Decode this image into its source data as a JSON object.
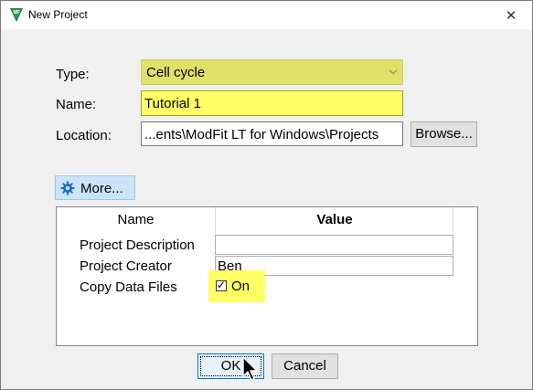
{
  "window": {
    "title": "New Project",
    "close_glyph": "✕",
    "app_icon": "modfit-app-icon"
  },
  "form": {
    "type_label": "Type:",
    "type_value": "Cell cycle",
    "type_arrow": "⌵",
    "name_label": "Name:",
    "name_value": "Tutorial 1",
    "location_label": "Location:",
    "location_value": "...ents\\ModFit LT for Windows\\Projects",
    "browse_label": "Browse..."
  },
  "more_button": {
    "label": "More...",
    "icon": "gear-icon"
  },
  "properties": {
    "header_name": "Name",
    "header_value": "Value",
    "rows": [
      {
        "name": "Project Description",
        "value": ""
      },
      {
        "name": "Project Creator",
        "value": "Ben"
      },
      {
        "name": "Copy Data Files",
        "value": "On",
        "checked": true
      }
    ]
  },
  "buttons": {
    "ok": "OK",
    "cancel": "Cancel"
  },
  "colors": {
    "highlight": "#ffff66",
    "accent": "#0078d7"
  }
}
